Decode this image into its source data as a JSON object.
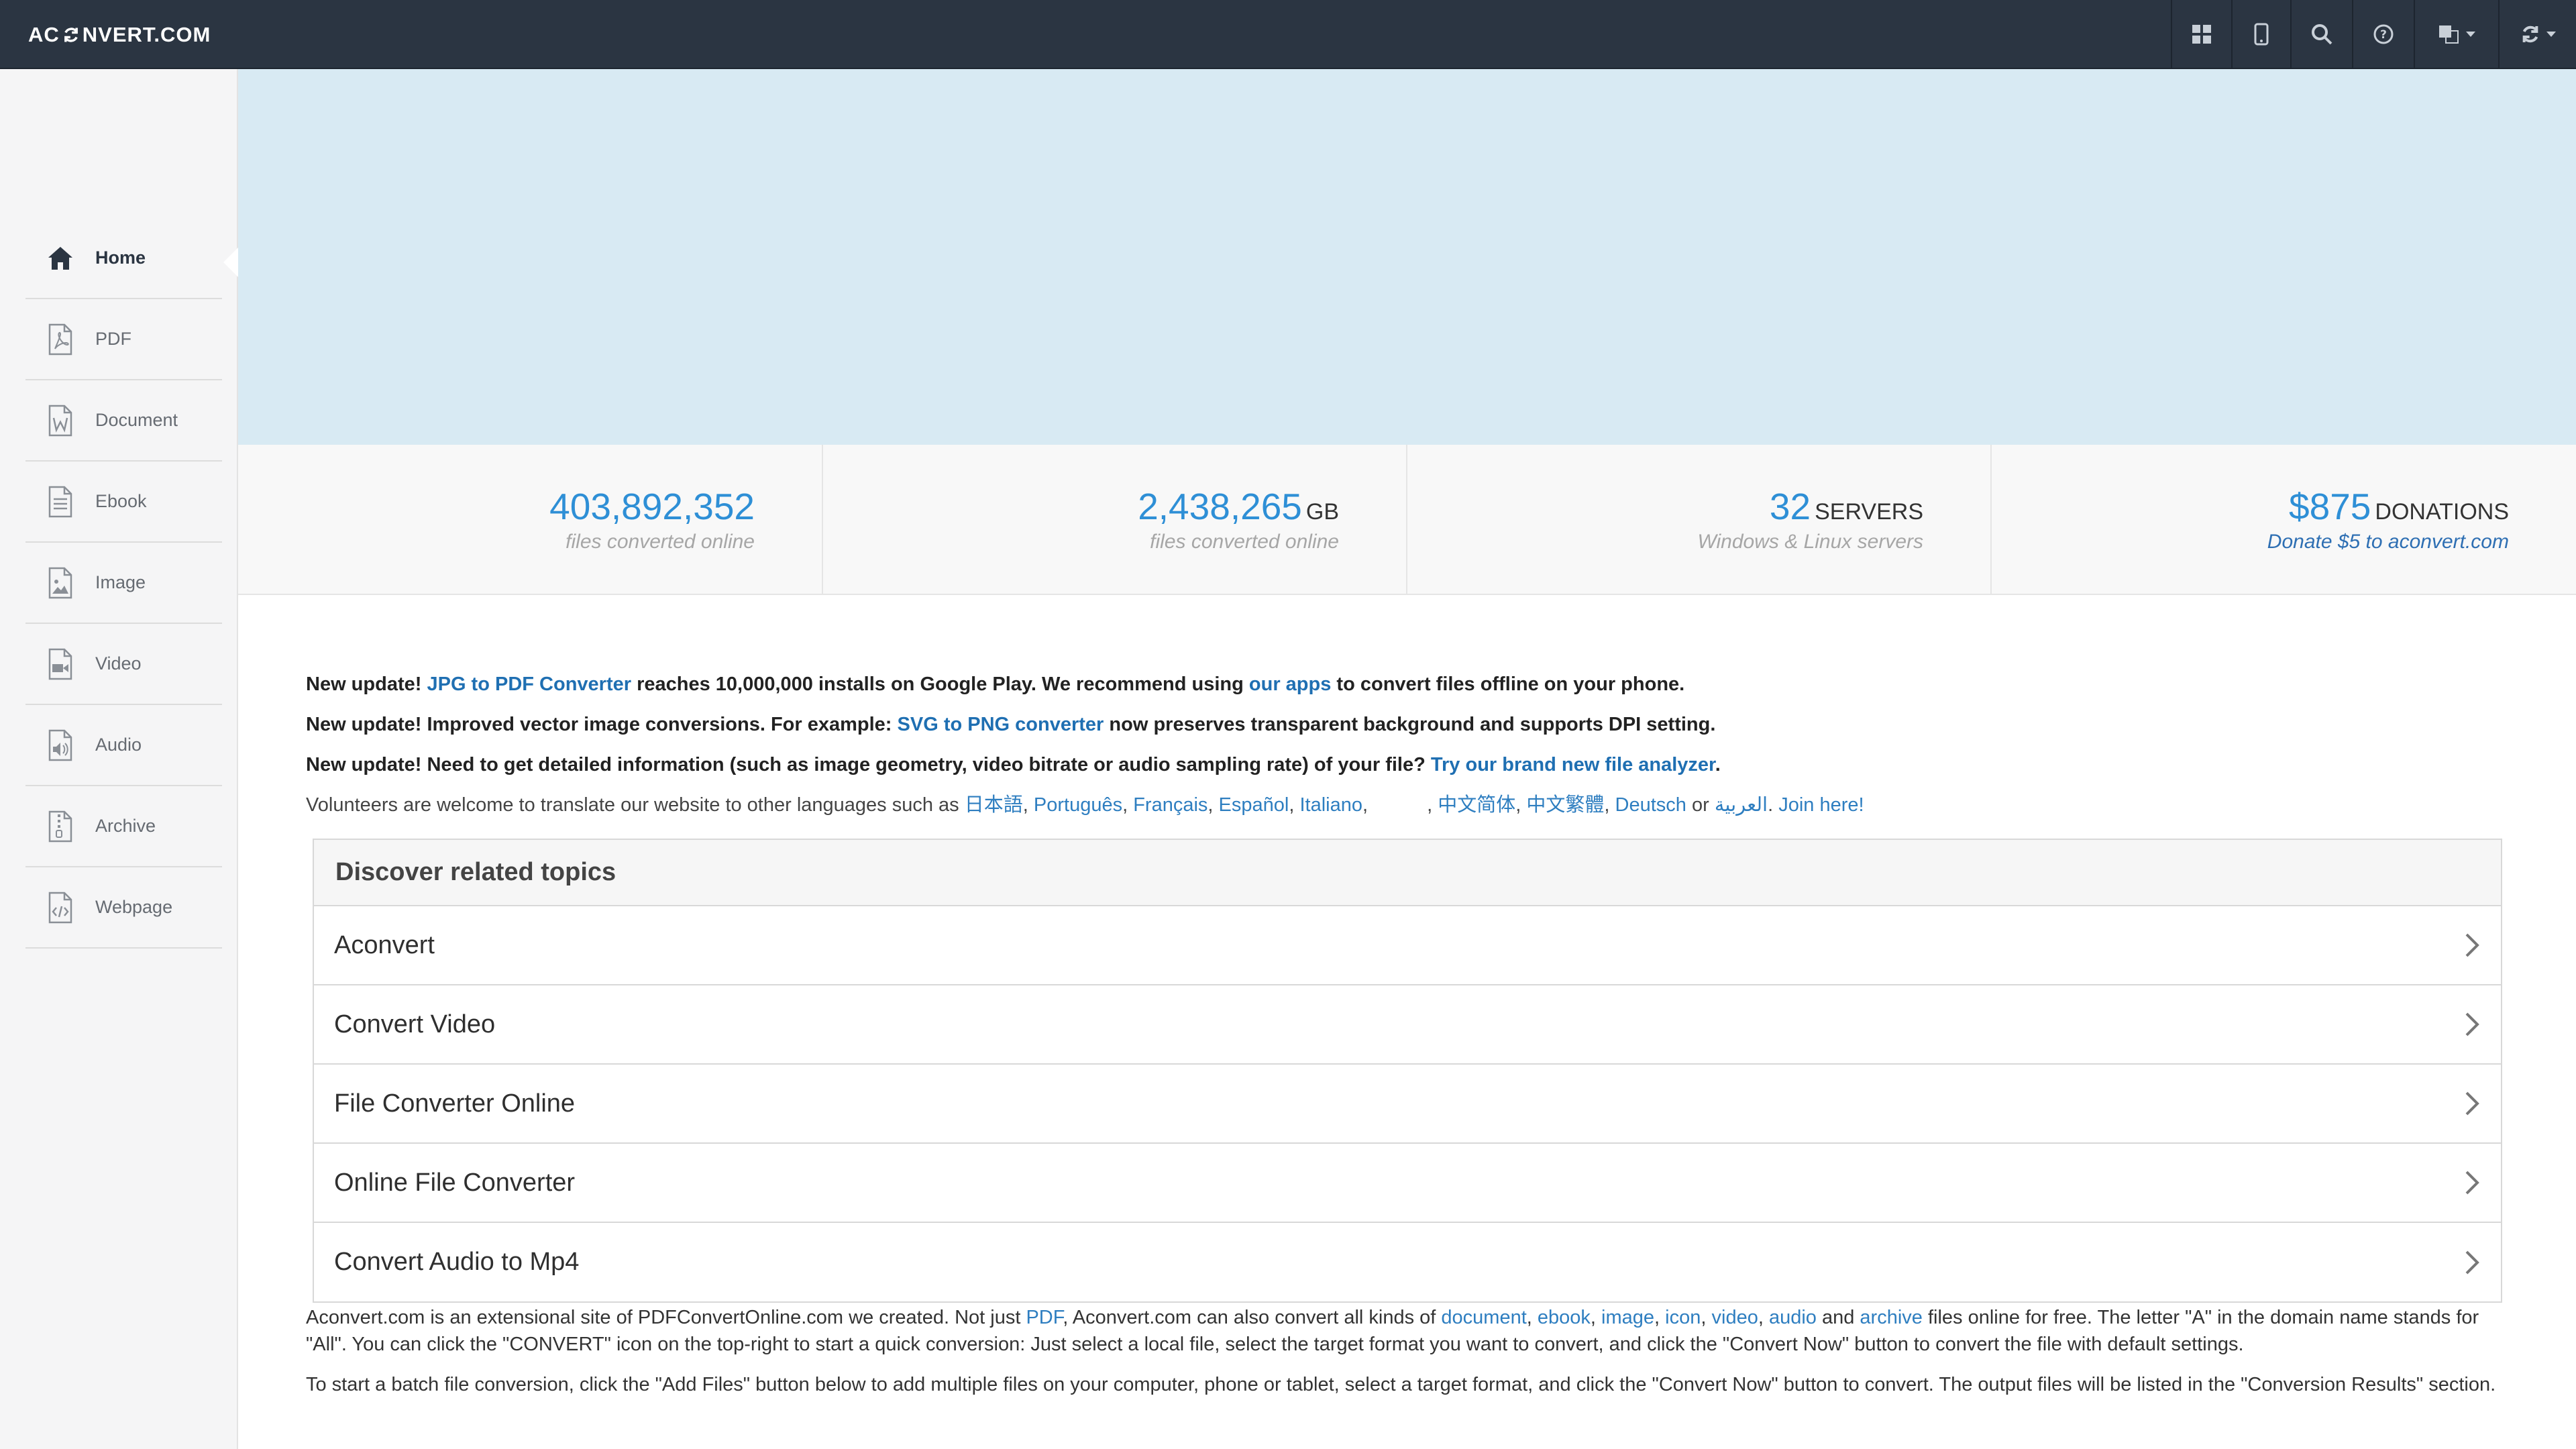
{
  "header": {
    "logo_prefix": "AC",
    "logo_suffix": "NVERT.COM",
    "icons": [
      "apps-grid-icon",
      "mobile-icon",
      "search-icon",
      "help-icon",
      "language-icon",
      "convert-icon"
    ]
  },
  "sidebar": {
    "items": [
      {
        "label": "Home",
        "icon": "home-icon"
      },
      {
        "label": "PDF",
        "icon": "pdf-file-icon"
      },
      {
        "label": "Document",
        "icon": "word-file-icon"
      },
      {
        "label": "Ebook",
        "icon": "text-file-icon"
      },
      {
        "label": "Image",
        "icon": "image-file-icon"
      },
      {
        "label": "Video",
        "icon": "video-file-icon"
      },
      {
        "label": "Audio",
        "icon": "audio-file-icon"
      },
      {
        "label": "Archive",
        "icon": "archive-file-icon"
      },
      {
        "label": "Webpage",
        "icon": "code-file-icon"
      }
    ]
  },
  "stats": [
    {
      "value": "403,892,352",
      "unit": "",
      "sub": "files converted online"
    },
    {
      "value": "2,438,265",
      "unit": "GB",
      "sub": "files converted online"
    },
    {
      "value": "32",
      "unit": "SERVERS",
      "sub": "Windows & Linux servers"
    },
    {
      "value": "$875",
      "unit": "DONATIONS",
      "sub": "Donate $5 to aconvert.com"
    }
  ],
  "news": {
    "n1": {
      "a": "New update! ",
      "link1": "JPG to PDF Converter",
      "b": " reaches 10,000,000 installs on Google Play. We recommend using ",
      "link2": "our apps",
      "c": " to convert files offline on your phone."
    },
    "n2": {
      "a": "New update! Improved vector image conversions. For example: ",
      "link1": "SVG to PNG converter",
      "b": " now preserves transparent background and supports DPI setting."
    },
    "n3": {
      "a": "New update! Need to get detailed information (such as image geometry, video bitrate or audio sampling rate) of your file? ",
      "link1": "Try our brand new file analyzer",
      "b": "."
    }
  },
  "volunteers": {
    "text": "Volunteers are welcome to translate our website to other languages such as ",
    "langs": [
      "日本語",
      "Português",
      "Français",
      "Español",
      "Italiano",
      "",
      "中文简体",
      "中文繁體",
      "Deutsch"
    ],
    "or": " or ",
    "arabic": "العربية",
    "join": "Join here!"
  },
  "topics": {
    "title": "Discover related topics",
    "items": [
      "Aconvert",
      "Convert Video",
      "File Converter Online",
      "Online File Converter",
      "Convert Audio to Mp4"
    ]
  },
  "about": {
    "p1_a": "Aconvert.com is an extensional site of PDFConvertOnline.com we created. Not just ",
    "pdf": "PDF",
    "p1_b": ", Aconvert.com can also convert all kinds of ",
    "document": "document",
    "ebook": "ebook",
    "image": "image",
    "icon": "icon",
    "video": "video",
    "audio": "audio",
    "and": " and ",
    "archive": "archive",
    "p1_c": " files online for free. The letter \"A\" in the domain name stands for \"All\". You can click the \"CONVERT\" icon on the top-right to start a quick conversion: Just select a local file, select the target format you want to convert, and click the \"Convert Now\" button to convert the file with default settings.",
    "p2": "To start a batch file conversion, click the \"Add Files\" button below to add multiple files on your computer, phone or tablet, select a target format, and click the \"Convert Now\" button to convert. The output files will be listed in the \"Conversion Results\" section."
  },
  "colors": {
    "topbar": "#2b3542",
    "accent": "#2e8fd6",
    "link": "#1f6fb2",
    "ad_banner": "#d8eaf3"
  }
}
